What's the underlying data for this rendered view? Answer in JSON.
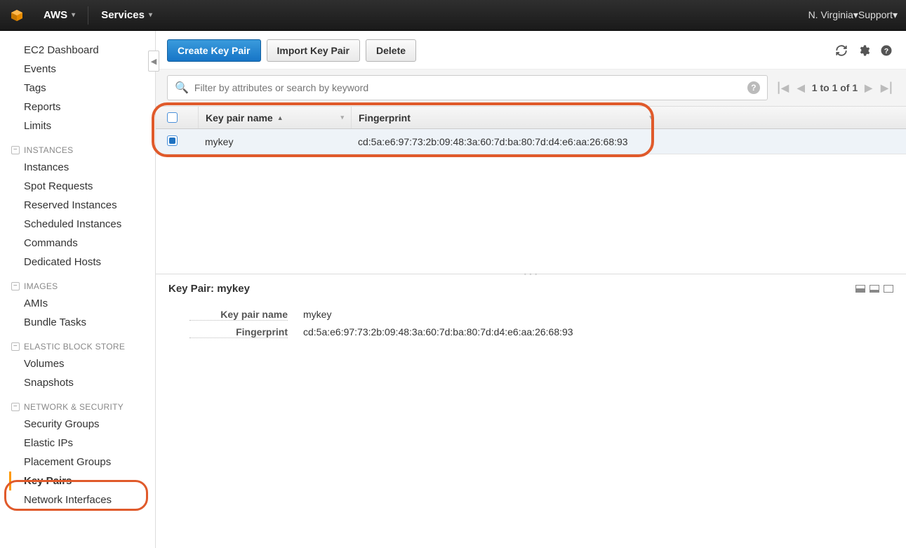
{
  "topbar": {
    "brand": "AWS",
    "services": "Services",
    "region": "N. Virginia",
    "support": "Support"
  },
  "sidebar": {
    "top_items": [
      "EC2 Dashboard",
      "Events",
      "Tags",
      "Reports",
      "Limits"
    ],
    "groups": [
      {
        "label": "INSTANCES",
        "items": [
          "Instances",
          "Spot Requests",
          "Reserved Instances",
          "Scheduled Instances",
          "Commands",
          "Dedicated Hosts"
        ]
      },
      {
        "label": "IMAGES",
        "items": [
          "AMIs",
          "Bundle Tasks"
        ]
      },
      {
        "label": "ELASTIC BLOCK STORE",
        "items": [
          "Volumes",
          "Snapshots"
        ]
      },
      {
        "label": "NETWORK & SECURITY",
        "items": [
          "Security Groups",
          "Elastic IPs",
          "Placement Groups",
          "Key Pairs",
          "Network Interfaces"
        ],
        "active_index": 3
      }
    ]
  },
  "actions": {
    "create": "Create Key Pair",
    "import": "Import Key Pair",
    "delete": "Delete"
  },
  "filter": {
    "placeholder": "Filter by attributes or search by keyword"
  },
  "pager": {
    "text": "1 to 1 of 1"
  },
  "columns": {
    "name": "Key pair name",
    "fingerprint": "Fingerprint"
  },
  "rows": [
    {
      "name": "mykey",
      "fingerprint": "cd:5a:e6:97:73:2b:09:48:3a:60:7d:ba:80:7d:d4:e6:aa:26:68:93",
      "selected": true
    }
  ],
  "detail": {
    "title_prefix": "Key Pair: ",
    "title_value": "mykey",
    "label_name": "Key pair name",
    "label_fp": "Fingerprint",
    "value_name": "mykey",
    "value_fp": "cd:5a:e6:97:73:2b:09:48:3a:60:7d:ba:80:7d:d4:e6:aa:26:68:93"
  }
}
